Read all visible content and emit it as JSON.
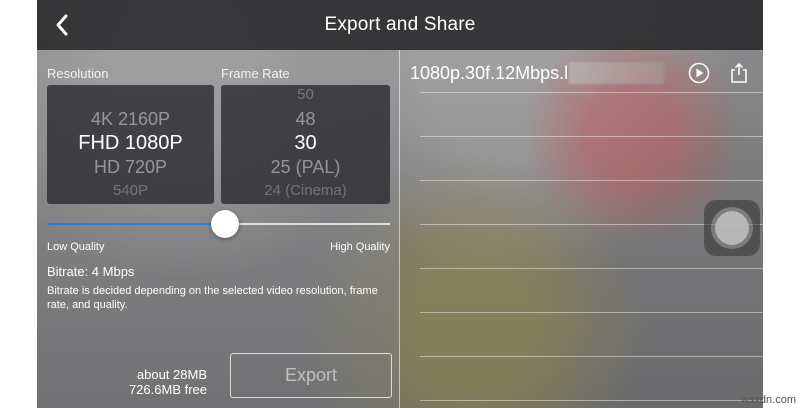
{
  "header": {
    "title": "Export and Share",
    "back_icon": "chevron-left-icon"
  },
  "resolution": {
    "label": "Resolution",
    "options": [
      "4K 2160P",
      "FHD 1080P",
      "HD 720P",
      "540P"
    ],
    "selected": "FHD 1080P"
  },
  "frame_rate": {
    "label": "Frame Rate",
    "options": [
      "50",
      "48",
      "30",
      "25 (PAL)",
      "24 (Cinema)"
    ],
    "selected": "30"
  },
  "quality": {
    "low_label": "Low Quality",
    "high_label": "High Quality",
    "value_fraction": 0.52,
    "accent_color": "#2f7de0"
  },
  "bitrate": {
    "text": "Bitrate: 4 Mbps",
    "description": "Bitrate is decided depending on the selected video resolution, frame rate, and quality."
  },
  "storage": {
    "estimated_size": "about 28MB",
    "free_space": "726.6MB free"
  },
  "export_button": {
    "label": "Export"
  },
  "preview": {
    "filename": "1080p.30f.12Mbps.l",
    "play_icon": "play-circle-icon",
    "share_icon": "share-icon"
  },
  "assistive_touch": {
    "icon": "assistive-touch-icon"
  },
  "watermark": "wsxdn.com"
}
